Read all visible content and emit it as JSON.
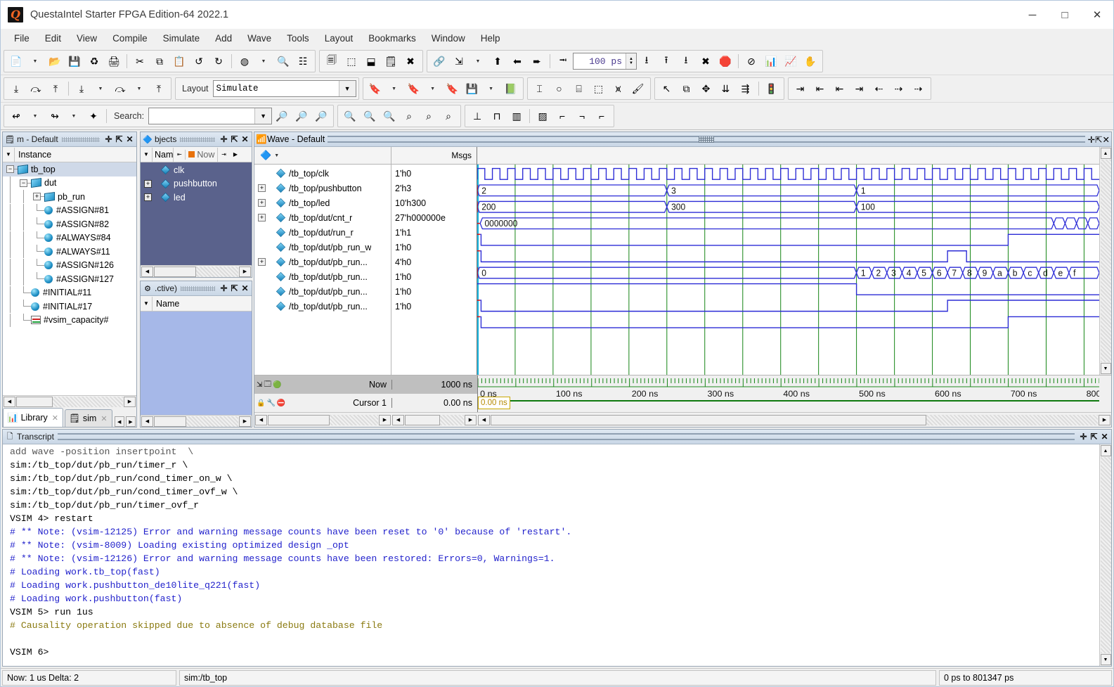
{
  "window": {
    "title": "QuestaIntel Starter FPGA Edition-64 2022.1",
    "logo_letter": "Q",
    "minimize": "─",
    "maximize": "□",
    "close": "✕"
  },
  "menu": [
    "File",
    "Edit",
    "View",
    "Compile",
    "Simulate",
    "Add",
    "Wave",
    "Tools",
    "Layout",
    "Bookmarks",
    "Window",
    "Help"
  ],
  "toolbar": {
    "layout_label": "Layout",
    "layout_value": "Simulate",
    "search_label": "Search:",
    "search_value": "",
    "run_length_value": "100 ps",
    "groups": [
      {
        "name": "standard",
        "icons": [
          "new-file-icon",
          "open-folder-icon",
          "save-icon",
          "reload-icon",
          "print-icon",
          "cut-icon",
          "copy-icon",
          "paste-icon",
          "undo-icon",
          "redo-icon",
          "compile-icon",
          "find-icon",
          "properties-icon"
        ]
      },
      {
        "name": "compile",
        "icons": [
          "compile-all-icon",
          "compile-selected-icon",
          "simulate-icon",
          "simulate-options-icon",
          "end-simulation-icon"
        ]
      },
      {
        "name": "simulate",
        "icons": [
          "link-icon",
          "step-into-icon",
          "step-up-icon",
          "continue-icon",
          "step-over-icon"
        ]
      },
      {
        "name": "run",
        "icons": [
          "restart-icon",
          "run-icon",
          "run-continue-icon",
          "run-all-icon",
          "break-icon",
          "stop-icon",
          "no-causality-icon",
          "profile-icon",
          "memory-icon",
          "hand-icon"
        ]
      },
      {
        "name": "wave-bookmark",
        "icons": [
          "bookmark-add-icon",
          "bookmark-remove-icon",
          "bookmark-edit-icon",
          "wave-save-icon",
          "wave-load-icon"
        ]
      },
      {
        "name": "wave-radix",
        "icons": [
          "insert-cursor-icon",
          "toggle-leaf-icon",
          "io-icon",
          "group-icon",
          "all-icon",
          "expand-icon"
        ]
      },
      {
        "name": "wave-edit",
        "icons": [
          "select-mode-icon",
          "zoom-mode-icon",
          "pan-mode-icon",
          "cursor-mode-icon",
          "edit-mode-icon",
          "signal-light-icon"
        ]
      },
      {
        "name": "nav",
        "icons": [
          "prev-transition-icon",
          "next-transition-icon",
          "find-transition-icon"
        ]
      },
      {
        "name": "zoom",
        "icons": [
          "zoom-in-icon",
          "zoom-out-icon",
          "zoom-full-icon",
          "zoom-cursor-icon",
          "zoom-range-icon",
          "zoom-select-icon"
        ]
      },
      {
        "name": "waveformat",
        "icons": [
          "analog-step-icon",
          "analog-interpolated-icon",
          "analog-backstep-icon",
          "format-dotted-icon",
          "format-rise-icon",
          "format-fall-icon",
          "format-edge-icon"
        ]
      },
      {
        "name": "bottomnav",
        "icons": [
          "find-prev-icon",
          "find-next-icon",
          "expand-all-icon"
        ]
      }
    ]
  },
  "sim_pane": {
    "title": "m - Default",
    "column_header": "Instance",
    "tree": [
      {
        "label": "tb_top",
        "depth": 0,
        "icon": "module-icon",
        "expander": "minus",
        "selected": true
      },
      {
        "label": "dut",
        "depth": 1,
        "icon": "module-icon",
        "expander": "minus",
        "selected": false
      },
      {
        "label": "pb_run",
        "depth": 2,
        "icon": "module-icon",
        "expander": "plus",
        "selected": false
      },
      {
        "label": "#ASSIGN#81",
        "depth": 2,
        "icon": "process-icon",
        "expander": "none",
        "selected": false
      },
      {
        "label": "#ASSIGN#82",
        "depth": 2,
        "icon": "process-icon",
        "expander": "none",
        "selected": false
      },
      {
        "label": "#ALWAYS#84",
        "depth": 2,
        "icon": "process-icon",
        "expander": "none",
        "selected": false
      },
      {
        "label": "#ALWAYS#11",
        "depth": 2,
        "icon": "process-icon",
        "expander": "none",
        "selected": false
      },
      {
        "label": "#ASSIGN#126",
        "depth": 2,
        "icon": "process-icon",
        "expander": "none",
        "selected": false
      },
      {
        "label": "#ASSIGN#127",
        "depth": 2,
        "icon": "process-icon",
        "expander": "none",
        "selected": false
      },
      {
        "label": "#INITIAL#11",
        "depth": 1,
        "icon": "process-icon",
        "expander": "none",
        "selected": false
      },
      {
        "label": "#INITIAL#17",
        "depth": 1,
        "icon": "process-icon",
        "expander": "none",
        "selected": false
      },
      {
        "label": "#vsim_capacity#",
        "depth": 1,
        "icon": "capacity-icon",
        "expander": "none",
        "selected": false
      }
    ],
    "tabs": [
      {
        "label": "Library",
        "icon": "library-icon",
        "active": true
      },
      {
        "label": "sim",
        "icon": "sim-icon",
        "active": false
      }
    ]
  },
  "objects_pane": {
    "title": "bjects",
    "column_name": "Nam",
    "now_label": "Now",
    "items": [
      {
        "label": "clk",
        "expander": "none"
      },
      {
        "label": "pushbutton",
        "expander": "plus"
      },
      {
        "label": "led",
        "expander": "plus"
      }
    ]
  },
  "processes_pane": {
    "title": ".ctive)",
    "column_header": "Name",
    "items": []
  },
  "wave": {
    "title": "Wave - Default",
    "msgs_header": "Msgs",
    "signals": [
      {
        "name": "/tb_top/clk",
        "value": "1'h0",
        "expander": "none"
      },
      {
        "name": "/tb_top/pushbutton",
        "value": "2'h3",
        "expander": "plus"
      },
      {
        "name": "/tb_top/led",
        "value": "10'h300",
        "expander": "plus"
      },
      {
        "name": "/tb_top/dut/cnt_r",
        "value": "27'h000000e",
        "expander": "plus"
      },
      {
        "name": "/tb_top/dut/run_r",
        "value": "1'h1",
        "expander": "none"
      },
      {
        "name": "/tb_top/dut/pb_run_w",
        "value": "1'h0",
        "expander": "none"
      },
      {
        "name": "/tb_top/dut/pb_run...",
        "value": "4'h0",
        "expander": "plus"
      },
      {
        "name": "/tb_top/dut/pb_run...",
        "value": "1'h0",
        "expander": "none"
      },
      {
        "name": "/tb_top/dut/pb_run...",
        "value": "1'h0",
        "expander": "none"
      },
      {
        "name": "/tb_top/dut/pb_run...",
        "value": "1'h0",
        "expander": "none"
      }
    ],
    "now_label": "Now",
    "now_value": "1000 ns",
    "cursor_label": "Cursor 1",
    "cursor_value": "0.00 ns",
    "cursor_tag": "0.00 ns",
    "axis_ticks": [
      "0 ns",
      "100 ns",
      "200 ns",
      "300 ns",
      "400 ns",
      "500 ns",
      "600 ns",
      "700 ns",
      "800"
    ]
  },
  "wave_data": {
    "time_start_ns": 0,
    "time_end_ns": 820,
    "clock_period_ns": 20,
    "bus_transitions": {
      "pushbutton": [
        {
          "t": 0,
          "v": "2"
        },
        {
          "t": 250,
          "v": "3"
        },
        {
          "t": 500,
          "v": "1"
        }
      ],
      "led": [
        {
          "t": 0,
          "v": "200"
        },
        {
          "t": 250,
          "v": "300"
        },
        {
          "t": 500,
          "v": "100"
        }
      ],
      "cnt_r": [
        {
          "t": 0,
          "v": "0000000"
        }
      ],
      "timer_r": [
        {
          "t": 0,
          "v": "0"
        },
        {
          "t": 500,
          "v": "1"
        },
        {
          "t": 520,
          "v": "2"
        },
        {
          "t": 540,
          "v": "3"
        },
        {
          "t": 560,
          "v": "4"
        },
        {
          "t": 580,
          "v": "5"
        },
        {
          "t": 600,
          "v": "6"
        },
        {
          "t": 620,
          "v": "7"
        },
        {
          "t": 640,
          "v": "8"
        },
        {
          "t": 660,
          "v": "9"
        },
        {
          "t": 680,
          "v": "a"
        },
        {
          "t": 700,
          "v": "b"
        },
        {
          "t": 720,
          "v": "c"
        },
        {
          "t": 740,
          "v": "d"
        },
        {
          "t": 760,
          "v": "e"
        },
        {
          "t": 780,
          "v": "f"
        }
      ]
    }
  },
  "transcript": {
    "title": "Transcript",
    "lines": [
      {
        "text": "add wave -position insertpoint  \\",
        "color": "clip"
      },
      {
        "text": "sim:/tb_top/dut/pb_run/timer_r \\",
        "color": "black"
      },
      {
        "text": "sim:/tb_top/dut/pb_run/cond_timer_on_w \\",
        "color": "black"
      },
      {
        "text": "sim:/tb_top/dut/pb_run/cond_timer_ovf_w \\",
        "color": "black"
      },
      {
        "text": "sim:/tb_top/dut/pb_run/timer_ovf_r",
        "color": "black"
      },
      {
        "text": "VSIM 4> restart",
        "color": "black"
      },
      {
        "text": "# ** Note: (vsim-12125) Error and warning message counts have been reset to '0' because of 'restart'.",
        "color": "blue"
      },
      {
        "text": "# ** Note: (vsim-8009) Loading existing optimized design _opt",
        "color": "blue"
      },
      {
        "text": "# ** Note: (vsim-12126) Error and warning message counts have been restored: Errors=0, Warnings=1.",
        "color": "blue"
      },
      {
        "text": "# Loading work.tb_top(fast)",
        "color": "blue"
      },
      {
        "text": "# Loading work.pushbutton_de10lite_q221(fast)",
        "color": "blue"
      },
      {
        "text": "# Loading work.pushbutton(fast)",
        "color": "blue"
      },
      {
        "text": "VSIM 5> run 1us",
        "color": "black"
      },
      {
        "text": "# Causality operation skipped due to absence of debug database file",
        "color": "olive"
      },
      {
        "text": "",
        "color": "black"
      },
      {
        "text": "VSIM 6>",
        "color": "black"
      }
    ]
  },
  "status": {
    "now": "Now: 1 us  Delta: 2",
    "context": "sim:/tb_top",
    "range": "0 ps to 801347 ps"
  }
}
